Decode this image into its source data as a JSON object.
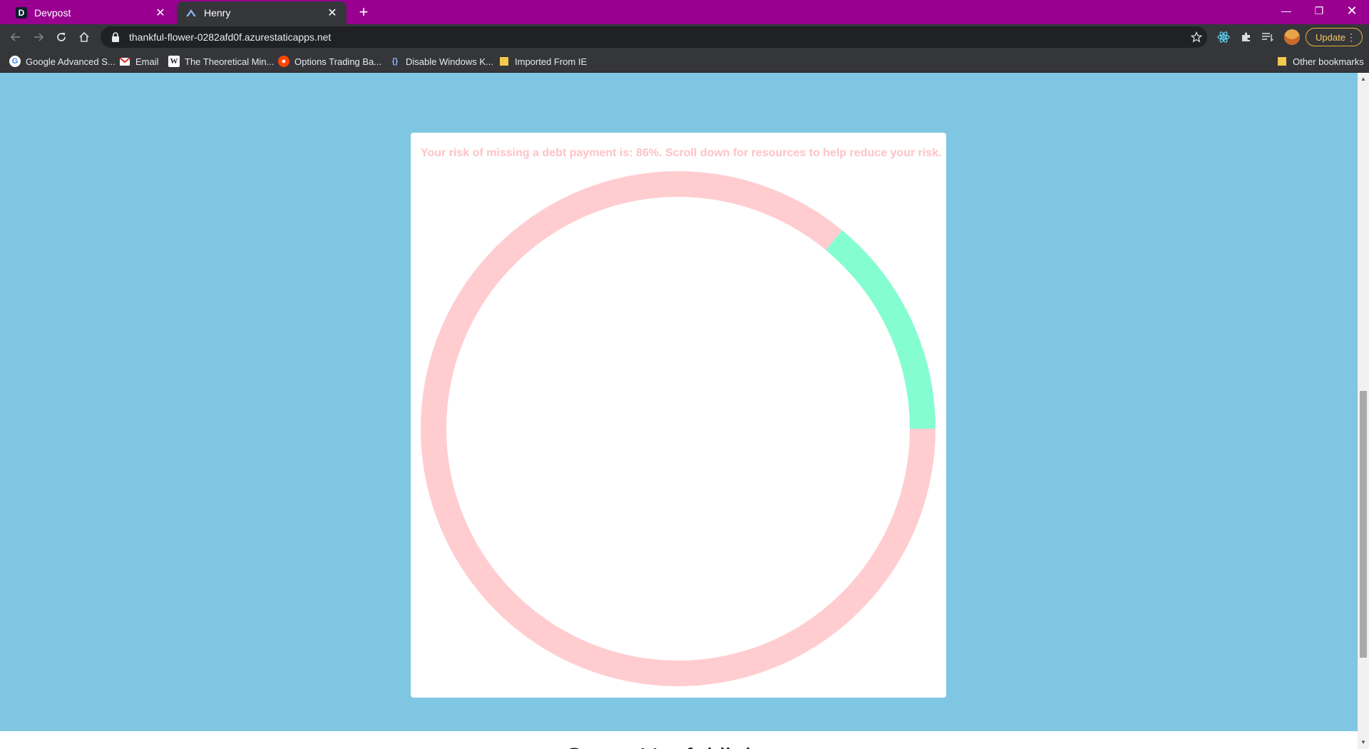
{
  "browser": {
    "tabs": [
      {
        "title": "Devpost",
        "favicon": "devpost-d-icon",
        "active": false
      },
      {
        "title": "Henry",
        "favicon": "henry-logo-icon",
        "active": true
      }
    ],
    "url": "thankful-flower-0282afd0f.azurestaticapps.net",
    "update_label": "Update",
    "bookmarks": [
      {
        "label": "Google Advanced S...",
        "icon": "google-icon"
      },
      {
        "label": "Email",
        "icon": "gmail-icon"
      },
      {
        "label": "The Theoretical Min...",
        "icon": "wikipedia-icon"
      },
      {
        "label": "Options Trading Ba...",
        "icon": "reddit-icon"
      },
      {
        "label": "Disable Windows K...",
        "icon": "bracket-icon"
      },
      {
        "label": "Imported From IE",
        "icon": "folder-icon"
      }
    ],
    "other_bookmarks_label": "Other bookmarks",
    "colors": {
      "tabstrip": "#990090",
      "toolbar": "#35363a"
    }
  },
  "page": {
    "risk_message": "Your risk of missing a debt payment is: 86%. Scroll down for resources to help reduce your risk.",
    "next_heading": "Some Useful links",
    "colors": {
      "background": "#7fc6e3",
      "risk": "#ffcdd0",
      "safe": "#84fdd1"
    }
  },
  "chart_data": {
    "type": "pie",
    "donut": true,
    "slices": [
      {
        "value": 86,
        "color": "#ffcdd0"
      },
      {
        "value": 14,
        "color": "#84fdd1"
      }
    ]
  }
}
